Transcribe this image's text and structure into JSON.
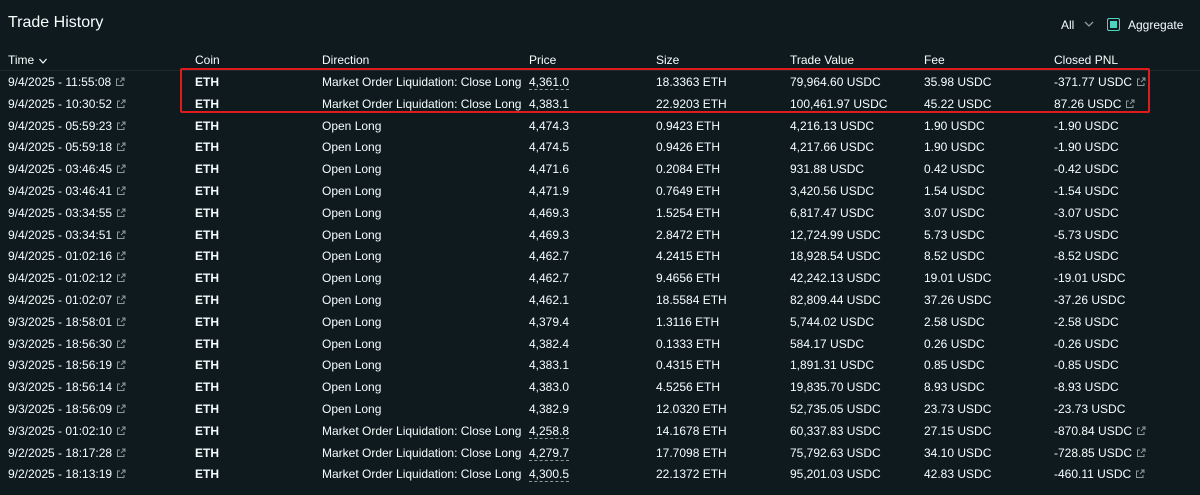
{
  "header": {
    "title": "Trade History",
    "filter_label": "All",
    "aggregate_label": "Aggregate"
  },
  "columns": {
    "time": "Time",
    "coin": "Coin",
    "direction": "Direction",
    "price": "Price",
    "size": "Size",
    "trade_value": "Trade Value",
    "fee": "Fee",
    "closed_pnl": "Closed PNL"
  },
  "colors": {
    "background": "#0f1a1f",
    "long_coin": "#5fe1c8",
    "long_direction": "#1fa67d",
    "short": "#ed7088",
    "accent": "#50d2c1",
    "highlight": "#e01b1b"
  },
  "rows": [
    {
      "time": "9/4/2025 - 11:55:08",
      "coin": "ETH",
      "direction": "Market Order Liquidation: Close Long",
      "price": "4,361.0",
      "size": "18.3363 ETH",
      "value": "79,964.60 USDC",
      "fee": "35.98 USDC",
      "pnl": "-371.77 USDC",
      "kind": "short",
      "pnl_link": true
    },
    {
      "time": "9/4/2025 - 10:30:52",
      "coin": "ETH",
      "direction": "Market Order Liquidation: Close Long",
      "price": "4,383.1",
      "size": "22.9203 ETH",
      "value": "100,461.97 USDC",
      "fee": "45.22 USDC",
      "pnl": "87.26 USDC",
      "kind": "short",
      "pnl_link": true
    },
    {
      "time": "9/4/2025 - 05:59:23",
      "coin": "ETH",
      "direction": "Open Long",
      "price": "4,474.3",
      "size": "0.9423 ETH",
      "value": "4,216.13 USDC",
      "fee": "1.90 USDC",
      "pnl": "-1.90 USDC",
      "kind": "long",
      "pnl_link": false
    },
    {
      "time": "9/4/2025 - 05:59:18",
      "coin": "ETH",
      "direction": "Open Long",
      "price": "4,474.5",
      "size": "0.9426 ETH",
      "value": "4,217.66 USDC",
      "fee": "1.90 USDC",
      "pnl": "-1.90 USDC",
      "kind": "long",
      "pnl_link": false
    },
    {
      "time": "9/4/2025 - 03:46:45",
      "coin": "ETH",
      "direction": "Open Long",
      "price": "4,471.6",
      "size": "0.2084 ETH",
      "value": "931.88 USDC",
      "fee": "0.42 USDC",
      "pnl": "-0.42 USDC",
      "kind": "long",
      "pnl_link": false
    },
    {
      "time": "9/4/2025 - 03:46:41",
      "coin": "ETH",
      "direction": "Open Long",
      "price": "4,471.9",
      "size": "0.7649 ETH",
      "value": "3,420.56 USDC",
      "fee": "1.54 USDC",
      "pnl": "-1.54 USDC",
      "kind": "long",
      "pnl_link": false
    },
    {
      "time": "9/4/2025 - 03:34:55",
      "coin": "ETH",
      "direction": "Open Long",
      "price": "4,469.3",
      "size": "1.5254 ETH",
      "value": "6,817.47 USDC",
      "fee": "3.07 USDC",
      "pnl": "-3.07 USDC",
      "kind": "long",
      "pnl_link": false
    },
    {
      "time": "9/4/2025 - 03:34:51",
      "coin": "ETH",
      "direction": "Open Long",
      "price": "4,469.3",
      "size": "2.8472 ETH",
      "value": "12,724.99 USDC",
      "fee": "5.73 USDC",
      "pnl": "-5.73 USDC",
      "kind": "long",
      "pnl_link": false
    },
    {
      "time": "9/4/2025 - 01:02:16",
      "coin": "ETH",
      "direction": "Open Long",
      "price": "4,462.7",
      "size": "4.2415 ETH",
      "value": "18,928.54 USDC",
      "fee": "8.52 USDC",
      "pnl": "-8.52 USDC",
      "kind": "long",
      "pnl_link": false
    },
    {
      "time": "9/4/2025 - 01:02:12",
      "coin": "ETH",
      "direction": "Open Long",
      "price": "4,462.7",
      "size": "9.4656 ETH",
      "value": "42,242.13 USDC",
      "fee": "19.01 USDC",
      "pnl": "-19.01 USDC",
      "kind": "long",
      "pnl_link": false
    },
    {
      "time": "9/4/2025 - 01:02:07",
      "coin": "ETH",
      "direction": "Open Long",
      "price": "4,462.1",
      "size": "18.5584 ETH",
      "value": "82,809.44 USDC",
      "fee": "37.26 USDC",
      "pnl": "-37.26 USDC",
      "kind": "long",
      "pnl_link": false
    },
    {
      "time": "9/3/2025 - 18:58:01",
      "coin": "ETH",
      "direction": "Open Long",
      "price": "4,379.4",
      "size": "1.3116 ETH",
      "value": "5,744.02 USDC",
      "fee": "2.58 USDC",
      "pnl": "-2.58 USDC",
      "kind": "long",
      "pnl_link": false
    },
    {
      "time": "9/3/2025 - 18:56:30",
      "coin": "ETH",
      "direction": "Open Long",
      "price": "4,382.4",
      "size": "0.1333 ETH",
      "value": "584.17 USDC",
      "fee": "0.26 USDC",
      "pnl": "-0.26 USDC",
      "kind": "long",
      "pnl_link": false
    },
    {
      "time": "9/3/2025 - 18:56:19",
      "coin": "ETH",
      "direction": "Open Long",
      "price": "4,383.1",
      "size": "0.4315 ETH",
      "value": "1,891.31 USDC",
      "fee": "0.85 USDC",
      "pnl": "-0.85 USDC",
      "kind": "long",
      "pnl_link": false
    },
    {
      "time": "9/3/2025 - 18:56:14",
      "coin": "ETH",
      "direction": "Open Long",
      "price": "4,383.0",
      "size": "4.5256 ETH",
      "value": "19,835.70 USDC",
      "fee": "8.93 USDC",
      "pnl": "-8.93 USDC",
      "kind": "long",
      "pnl_link": false
    },
    {
      "time": "9/3/2025 - 18:56:09",
      "coin": "ETH",
      "direction": "Open Long",
      "price": "4,382.9",
      "size": "12.0320 ETH",
      "value": "52,735.05 USDC",
      "fee": "23.73 USDC",
      "pnl": "-23.73 USDC",
      "kind": "long",
      "pnl_link": false
    },
    {
      "time": "9/3/2025 - 01:02:10",
      "coin": "ETH",
      "direction": "Market Order Liquidation: Close Long",
      "price": "4,258.8",
      "size": "14.1678 ETH",
      "value": "60,337.83 USDC",
      "fee": "27.15 USDC",
      "pnl": "-870.84 USDC",
      "kind": "short",
      "pnl_link": true
    },
    {
      "time": "9/2/2025 - 18:17:28",
      "coin": "ETH",
      "direction": "Market Order Liquidation: Close Long",
      "price": "4,279.7",
      "size": "17.7098 ETH",
      "value": "75,792.63 USDC",
      "fee": "34.10 USDC",
      "pnl": "-728.85 USDC",
      "kind": "short",
      "pnl_link": true
    },
    {
      "time": "9/2/2025 - 18:13:19",
      "coin": "ETH",
      "direction": "Market Order Liquidation: Close Long",
      "price": "4,300.5",
      "size": "22.1372 ETH",
      "value": "95,201.03 USDC",
      "fee": "42.83 USDC",
      "pnl": "-460.11 USDC",
      "kind": "short",
      "pnl_link": true
    }
  ]
}
